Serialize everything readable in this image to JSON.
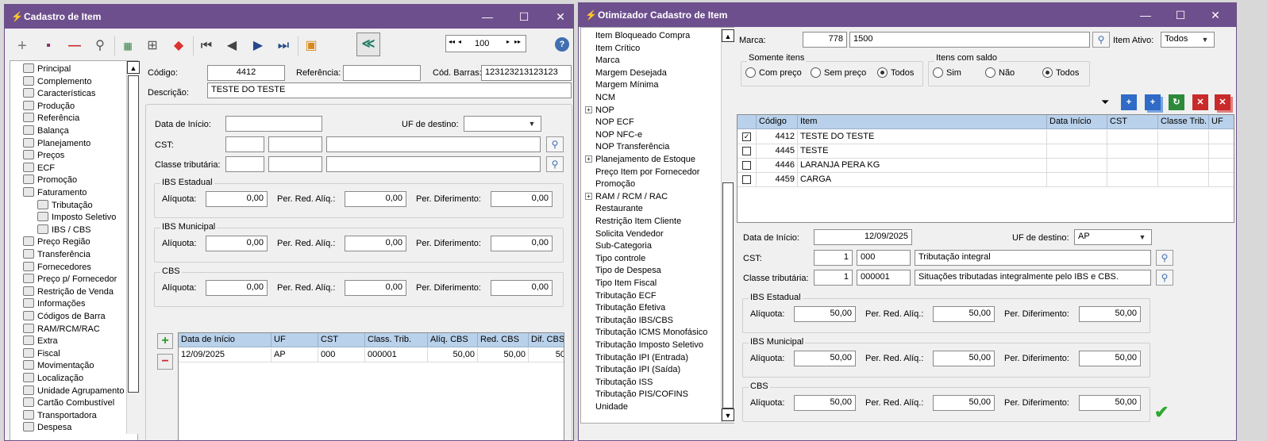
{
  "left_window": {
    "title": "Cadastro de Item",
    "nav_value": "100",
    "tree": [
      {
        "label": "Principal"
      },
      {
        "label": "Complemento"
      },
      {
        "label": "Características"
      },
      {
        "label": "Produção"
      },
      {
        "label": "Referência"
      },
      {
        "label": "Balança"
      },
      {
        "label": "Planejamento"
      },
      {
        "label": "Preços"
      },
      {
        "label": "ECF"
      },
      {
        "label": "Promoção"
      },
      {
        "label": "Faturamento"
      },
      {
        "label": "Tributação"
      },
      {
        "label": "Imposto Seletivo"
      },
      {
        "label": "IBS / CBS"
      },
      {
        "label": "Preço Região"
      },
      {
        "label": "Transferência"
      },
      {
        "label": "Fornecedores"
      },
      {
        "label": "Preço p/ Fornecedor"
      },
      {
        "label": "Restrição de Venda"
      },
      {
        "label": "Informações"
      },
      {
        "label": "Códigos de Barra"
      },
      {
        "label": "RAM/RCM/RAC"
      },
      {
        "label": "Extra"
      },
      {
        "label": "Fiscal"
      },
      {
        "label": "Movimentação"
      },
      {
        "label": "Localização"
      },
      {
        "label": "Unidade Agrupamento"
      },
      {
        "label": "Cartão Combustível"
      },
      {
        "label": "Transportadora"
      },
      {
        "label": "Despesa"
      }
    ],
    "codigo_label": "Código:",
    "codigo": "4412",
    "referencia_label": "Referência:",
    "referencia": "",
    "cod_barras_label": "Cód. Barras:",
    "cod_barras": "123123213123123",
    "descricao_label": "Descrição:",
    "descricao": "TESTE DO TESTE",
    "data_inicio_label": "Data de Início:",
    "data_inicio": "",
    "uf_destino_label": "UF de destino:",
    "uf_destino": "",
    "cst_label": "CST:",
    "classe_label": "Classe tributária:",
    "groups": [
      {
        "title": "IBS Estadual",
        "aliquota": "0,00",
        "red": "0,00",
        "dif": "0,00"
      },
      {
        "title": "IBS Municipal",
        "aliquota": "0,00",
        "red": "0,00",
        "dif": "0,00"
      },
      {
        "title": "CBS",
        "aliquota": "0,00",
        "red": "0,00",
        "dif": "0,00"
      }
    ],
    "aliquota_label": "Alíquota:",
    "red_label": "Per. Red. Alíq.:",
    "dif_label": "Per. Diferimento:",
    "grid_headers": [
      "Data de Início",
      "UF",
      "CST",
      "Class. Trib.",
      "Alíq. CBS",
      "Red. CBS",
      "Dif. CBS"
    ],
    "grid_rows": [
      [
        "12/09/2025",
        "AP",
        "000",
        "000001",
        "50,00",
        "50,00",
        "50"
      ]
    ]
  },
  "right_window": {
    "title": "Otimizador Cadastro de Item",
    "tree": [
      {
        "label": "Item Bloqueado Compra"
      },
      {
        "label": "Item Crítico"
      },
      {
        "label": "Marca"
      },
      {
        "label": "Margem Desejada"
      },
      {
        "label": "Margem Mínima"
      },
      {
        "label": "NCM"
      },
      {
        "label": "NOP"
      },
      {
        "label": "NOP ECF"
      },
      {
        "label": "NOP NFC-e"
      },
      {
        "label": "NOP Transferência"
      },
      {
        "label": "Planejamento de Estoque"
      },
      {
        "label": "Preço Item por Fornecedor"
      },
      {
        "label": "Promoção"
      },
      {
        "label": "RAM / RCM / RAC"
      },
      {
        "label": "Restaurante"
      },
      {
        "label": "Restrição Item Cliente"
      },
      {
        "label": "Solicita Vendedor"
      },
      {
        "label": "Sub-Categoria"
      },
      {
        "label": "Tipo controle"
      },
      {
        "label": "Tipo de Despesa"
      },
      {
        "label": "Tipo Item Fiscal"
      },
      {
        "label": "Tributação ECF"
      },
      {
        "label": "Tributação Efetiva"
      },
      {
        "label": "Tributação IBS/CBS"
      },
      {
        "label": "Tributação ICMS Monofásico"
      },
      {
        "label": "Tributação Imposto Seletivo"
      },
      {
        "label": "Tributação IPI (Entrada)"
      },
      {
        "label": "Tributação IPI (Saída)"
      },
      {
        "label": "Tributação ISS"
      },
      {
        "label": "Tributação PIS/COFINS"
      },
      {
        "label": "Unidade"
      }
    ],
    "marca_label": "Marca:",
    "marca_codigo": "778",
    "marca_nome": "1500",
    "item_ativo_label": "Item Ativo:",
    "item_ativo": "Todos",
    "somente_itens": {
      "title": "Somente itens",
      "options": [
        "Com preço",
        "Sem preço",
        "Todos"
      ],
      "selected": "Todos"
    },
    "itens_saldo": {
      "title": "Itens com saldo",
      "options": [
        "Sim",
        "Não",
        "Todos"
      ],
      "selected": "Todos"
    },
    "grid_headers": [
      "Código",
      "Item",
      "Data Início",
      "CST",
      "Classe Trib.",
      "UF"
    ],
    "grid_rows": [
      {
        "checked": true,
        "codigo": "4412",
        "item": "TESTE DO TESTE"
      },
      {
        "checked": false,
        "codigo": "4445",
        "item": "TESTE"
      },
      {
        "checked": false,
        "codigo": "4446",
        "item": "LARANJA PERA KG"
      },
      {
        "checked": false,
        "codigo": "4459",
        "item": "CARGA"
      }
    ],
    "data_inicio_label": "Data de Início:",
    "data_inicio": "12/09/2025",
    "uf_destino_label": "UF de destino:",
    "uf_destino": "AP",
    "cst_label": "CST:",
    "cst_code": "1",
    "cst_value": "000",
    "cst_desc": "Tributação integral",
    "classe_label": "Classe tributária:",
    "classe_code": "1",
    "classe_value": "000001",
    "classe_desc": "Situações tributadas integralmente pelo IBS e CBS.",
    "groups": [
      {
        "title": "IBS Estadual",
        "aliquota": "50,00",
        "red": "50,00",
        "dif": "50,00"
      },
      {
        "title": "IBS Municipal",
        "aliquota": "50,00",
        "red": "50,00",
        "dif": "50,00"
      },
      {
        "title": "CBS",
        "aliquota": "50,00",
        "red": "50,00",
        "dif": "50,00"
      }
    ],
    "aliquota_label": "Alíquota:",
    "red_label": "Per. Red. Alíq.:",
    "dif_label": "Per. Diferimento:"
  }
}
